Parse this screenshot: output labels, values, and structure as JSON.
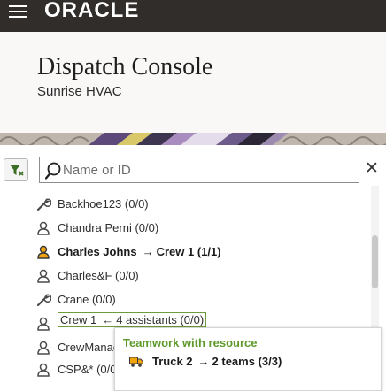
{
  "brand": {
    "logo_text": "ORACLE",
    "topbar_color": "#312d2a"
  },
  "header": {
    "title": "Dispatch Console",
    "subtitle": "Sunrise HVAC"
  },
  "search": {
    "placeholder": "Name or ID",
    "value": ""
  },
  "resources": [
    {
      "icon": "wrench-icon",
      "label": "Backhoe123 (0/0)",
      "bold": false
    },
    {
      "icon": "person-icon",
      "label": "Chandra Perni (0/0)",
      "bold": false
    },
    {
      "icon": "person-icon",
      "icon_color": "#f0a30a",
      "name": "Charles Johns",
      "arrow": "→",
      "rest": "Crew 1 (1/1)",
      "bold": true
    },
    {
      "icon": "person-icon",
      "label": "Charles&F (0/0)",
      "bold": false
    },
    {
      "icon": "wrench-icon",
      "label": "Crane (0/0)",
      "bold": false
    },
    {
      "icon": "person-icon",
      "name": "Crew 1",
      "arrow": "←",
      "rest": "4 assistants (0/0)",
      "outlined": true
    },
    {
      "icon": "person-icon",
      "label": "CrewManag"
    },
    {
      "icon": "person-icon",
      "label": "CSP&* (0/0"
    }
  ],
  "popup": {
    "title": "Teamwork with resource",
    "title_color": "#5e9a2b",
    "row": {
      "icon": "truck-icon",
      "name": "Truck 2",
      "arrow": "→",
      "rest": "2 teams (3/3)"
    }
  }
}
